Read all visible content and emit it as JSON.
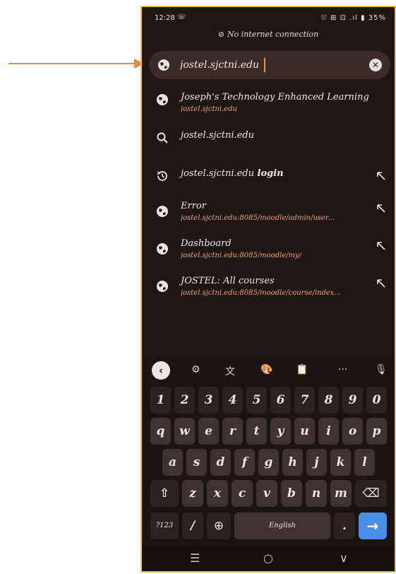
{
  "status_bar": {
    "time": "12:28",
    "notification": "☏",
    "icons": "⛆ ⊞ ⊡ .ıl ▮ 35%"
  },
  "banner": {
    "icon": "⊘",
    "text": "No internet connection"
  },
  "search": {
    "value": "jostel.sjctni.edu"
  },
  "suggestions": [
    {
      "type": "site",
      "title": "Joseph's Technology Enhanced Learning",
      "url": "jostel.sjctni.edu"
    },
    {
      "type": "search",
      "title": "jostel.sjctni.edu"
    },
    {
      "type": "history",
      "title": "jostel.sjctni.edu",
      "bold": " login"
    },
    {
      "type": "site",
      "title": "Error",
      "url": "jostel.sjctni.edu:8085/moodle/admin/user..."
    },
    {
      "type": "site",
      "title": "Dashboard",
      "url": "jostel.sjctni.edu:8085/moodle/my/"
    },
    {
      "type": "site",
      "title": "JOSTEL: All courses",
      "url": "jostel.sjctni.edu:8085/moodle/course/index..."
    }
  ],
  "keyboard": {
    "tools": [
      "⚙",
      "文",
      "🎨",
      "📋",
      "···",
      "🎙"
    ],
    "row_numbers": [
      "1",
      "2",
      "3",
      "4",
      "5",
      "6",
      "7",
      "8",
      "9",
      "0"
    ],
    "row_q": [
      "q",
      "w",
      "e",
      "r",
      "t",
      "y",
      "u",
      "i",
      "o",
      "p"
    ],
    "row_a": [
      "a",
      "s",
      "d",
      "f",
      "g",
      "h",
      "j",
      "k",
      "l"
    ],
    "row_z": [
      "z",
      "x",
      "c",
      "v",
      "b",
      "n",
      "m"
    ],
    "shift": "⇧",
    "backspace": "⌫",
    "symbols": "?123",
    "slash": "/",
    "globe": "⊕",
    "space": "English",
    "period": ".",
    "enter": "→"
  },
  "navbar": {
    "recents": "☰",
    "home": "○",
    "back": "∨"
  },
  "colors": {
    "accent": "#f08a2c",
    "phone_border": "#f2c23c",
    "enter_key": "#4b8ee8"
  }
}
